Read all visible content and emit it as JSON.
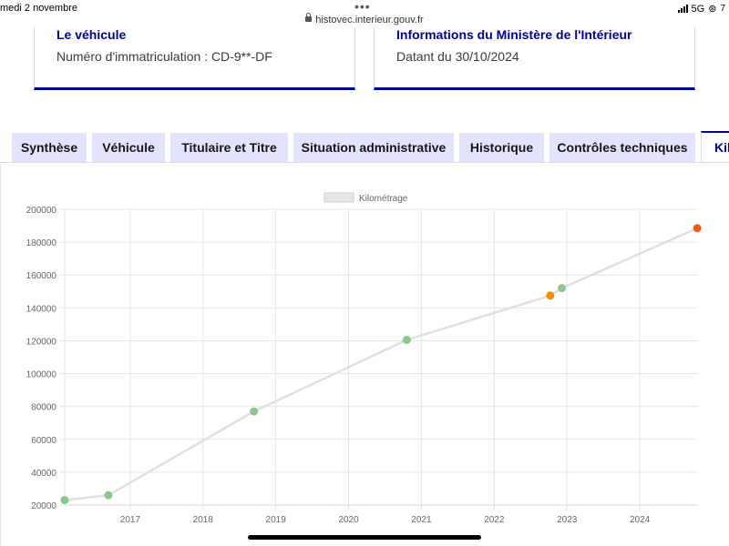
{
  "status_bar": {
    "date": "medi 2 novembre",
    "url": "histovec.interieur.gouv.fr",
    "network": "5G",
    "battery": "7"
  },
  "cards": [
    {
      "title": "Le véhicule",
      "text": "Numéro d'immatriculation : CD-9**-DF"
    },
    {
      "title": "Informations du Ministère de l'Intérieur",
      "text": "Datant du 30/10/2024"
    }
  ],
  "tabs": [
    {
      "label": "Synthèse"
    },
    {
      "label": "Véhicule"
    },
    {
      "label": "Titulaire et Titre"
    },
    {
      "label": "Situation administrative"
    },
    {
      "label": "Historique"
    },
    {
      "label": "Contrôles techniques"
    },
    {
      "label": "Kil"
    }
  ],
  "chart_data": {
    "type": "line",
    "legend": "Kilométrage",
    "legend_position": "top",
    "grid": true,
    "xlim": [
      2016.1,
      2024.8
    ],
    "ylim": [
      20000,
      200000
    ],
    "x_ticks": [
      "2017",
      "2018",
      "2019",
      "2020",
      "2021",
      "2022",
      "2023",
      "2024"
    ],
    "y_ticks": [
      "20000",
      "40000",
      "60000",
      "80000",
      "100000",
      "120000",
      "140000",
      "160000",
      "180000",
      "200000"
    ],
    "line_color": "#e0e0e0",
    "series": [
      {
        "name": "Kilométrage",
        "points": [
          {
            "x": 2016.1,
            "y": 23000,
            "color": "#8fc38f"
          },
          {
            "x": 2016.7,
            "y": 26000,
            "color": "#8fc38f"
          },
          {
            "x": 2018.7,
            "y": 77000,
            "color": "#8fc38f"
          },
          {
            "x": 2020.8,
            "y": 120500,
            "color": "#8fc38f"
          },
          {
            "x": 2022.77,
            "y": 147500,
            "color": "#f39200"
          },
          {
            "x": 2022.93,
            "y": 152000,
            "color": "#8fc38f"
          },
          {
            "x": 2024.79,
            "y": 188500,
            "color": "#f95c1c"
          }
        ]
      }
    ]
  }
}
